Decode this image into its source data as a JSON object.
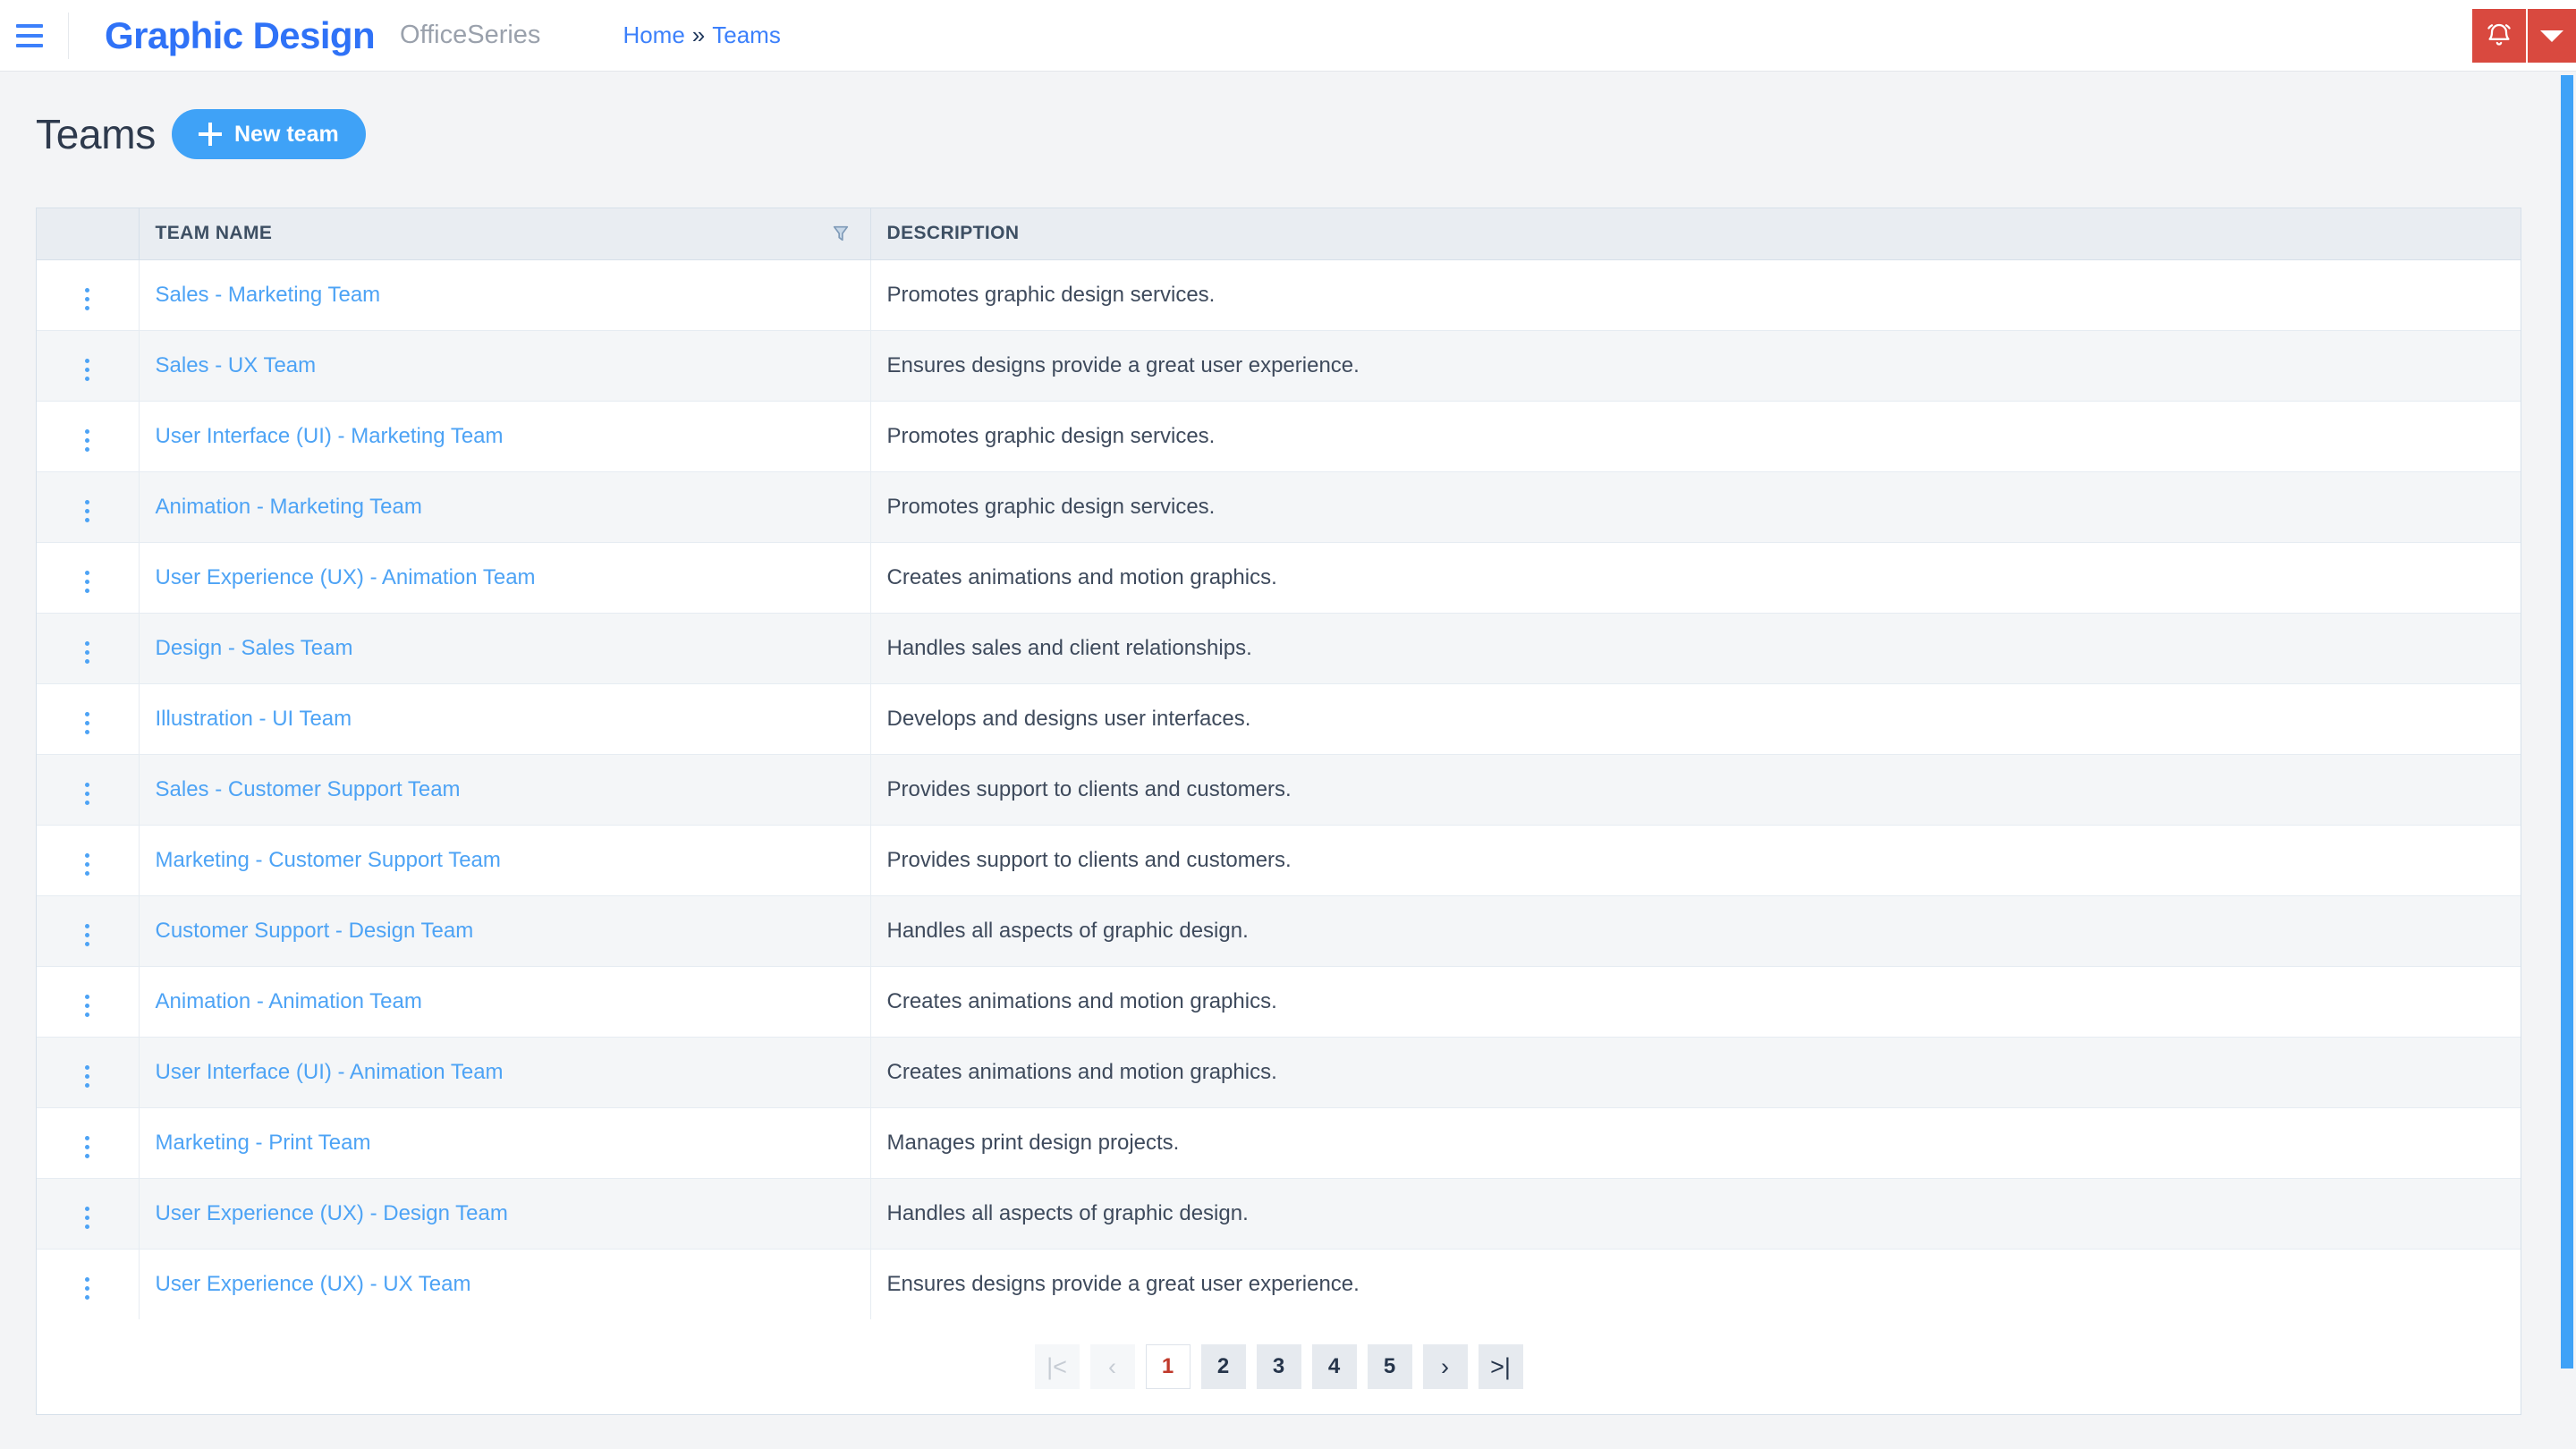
{
  "topbar": {
    "menu_icon": "hamburger-icon",
    "brand": "Graphic Design",
    "brand_sub": "OfficeSeries",
    "breadcrumb": {
      "home": "Home",
      "separator": "»",
      "current": "Teams"
    },
    "alert_icon": "bell-icon",
    "alert_caret_icon": "chevron-down-icon",
    "alert_color": "#d9493f"
  },
  "page": {
    "title": "Teams",
    "new_button": {
      "label": "New team",
      "icon": "plus-icon",
      "color": "#3fa2f7"
    }
  },
  "table": {
    "columns": [
      "",
      "TEAM NAME",
      "DESCRIPTION"
    ],
    "filter_icon": "filter-icon",
    "row_menu_icon": "kebab-menu-icon",
    "rows": [
      {
        "name": "Sales - Marketing Team",
        "description": "Promotes graphic design services."
      },
      {
        "name": "Sales - UX Team",
        "description": "Ensures designs provide a great user experience."
      },
      {
        "name": "User Interface (UI) - Marketing Team",
        "description": "Promotes graphic design services."
      },
      {
        "name": "Animation - Marketing Team",
        "description": "Promotes graphic design services."
      },
      {
        "name": "User Experience (UX) - Animation Team",
        "description": "Creates animations and motion graphics."
      },
      {
        "name": "Design - Sales Team",
        "description": "Handles sales and client relationships."
      },
      {
        "name": "Illustration - UI Team",
        "description": "Develops and designs user interfaces."
      },
      {
        "name": "Sales - Customer Support Team",
        "description": "Provides support to clients and customers."
      },
      {
        "name": "Marketing - Customer Support Team",
        "description": "Provides support to clients and customers."
      },
      {
        "name": "Customer Support - Design Team",
        "description": "Handles all aspects of graphic design."
      },
      {
        "name": "Animation - Animation Team",
        "description": "Creates animations and motion graphics."
      },
      {
        "name": "User Interface (UI) - Animation Team",
        "description": "Creates animations and motion graphics."
      },
      {
        "name": "Marketing - Print Team",
        "description": "Manages print design projects."
      },
      {
        "name": "User Experience (UX) - Design Team",
        "description": "Handles all aspects of graphic design."
      },
      {
        "name": "User Experience (UX) - UX Team",
        "description": "Ensures designs provide a great user experience."
      }
    ]
  },
  "pagination": {
    "first": "|<",
    "prev": "‹",
    "pages": [
      "1",
      "2",
      "3",
      "4",
      "5"
    ],
    "active_page": "1",
    "next": "›",
    "last": ">|",
    "active_color": "#c0392b"
  }
}
